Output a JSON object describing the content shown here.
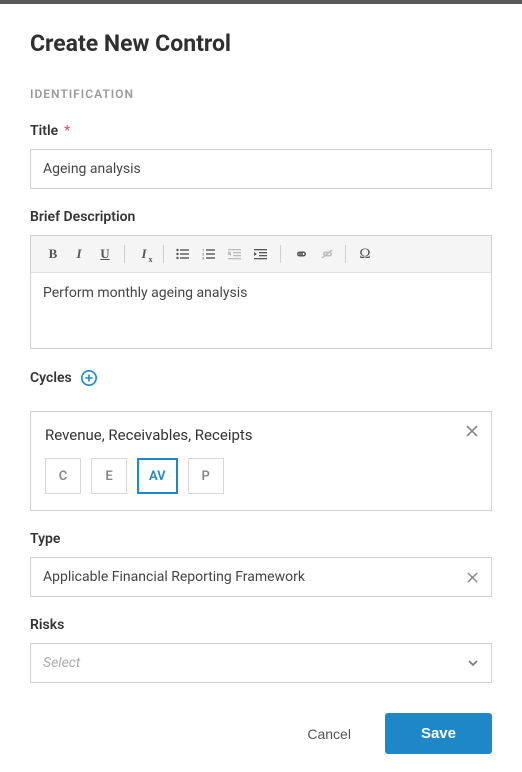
{
  "page": {
    "title": "Create New Control",
    "section": "IDENTIFICATION"
  },
  "title_field": {
    "label": "Title",
    "required_mark": "*",
    "value": "Ageing analysis"
  },
  "description": {
    "label": "Brief Description",
    "value": "Perform monthly ageing analysis"
  },
  "toolbar": {
    "bold": "B",
    "italic": "I",
    "underline": "U",
    "clearfmt": "Ix",
    "omega": "Ω"
  },
  "cycles": {
    "label": "Cycles",
    "group_title": "Revenue, Receivables, Receipts",
    "items": [
      {
        "code": "C",
        "selected": false
      },
      {
        "code": "E",
        "selected": false
      },
      {
        "code": "AV",
        "selected": true
      },
      {
        "code": "P",
        "selected": false
      }
    ]
  },
  "type_field": {
    "label": "Type",
    "value": "Applicable Financial Reporting Framework"
  },
  "risks": {
    "label": "Risks",
    "placeholder": "Select"
  },
  "footer": {
    "cancel": "Cancel",
    "save": "Save"
  }
}
